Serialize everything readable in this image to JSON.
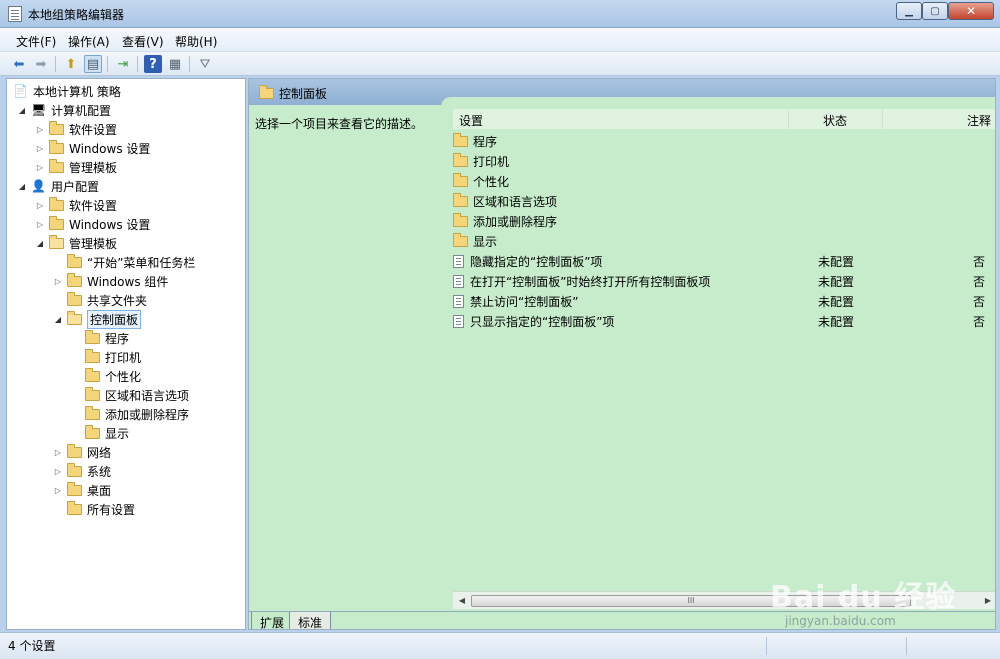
{
  "window": {
    "title": "本地组策略编辑器",
    "min_label": "▁",
    "max_label": "▢",
    "close_label": "✕"
  },
  "menu": [
    "文件(F)",
    "操作(A)",
    "查看(V)",
    "帮助(H)"
  ],
  "toolbar": {
    "icons": [
      "back-icon",
      "forward-icon",
      "up-folder-icon",
      "show-hide-tree-icon",
      "export-icon",
      "help-icon",
      "properties-icon",
      "filter-icon"
    ],
    "glyphs": {
      "back": "⬅",
      "forward": "➡",
      "up": "⬆",
      "tree": "▤",
      "export": "⇥",
      "help": "?",
      "props": "▦",
      "filter": "⛛"
    }
  },
  "tree": {
    "root": "本地计算机 策略",
    "computer_config": "计算机配置",
    "computer_software": "软件设置",
    "computer_windows": "Windows 设置",
    "computer_admin": "管理模板",
    "user_config": "用户配置",
    "user_software": "软件设置",
    "user_windows": "Windows 设置",
    "user_admin": "管理模板",
    "start_menu": "“开始”菜单和任务栏",
    "windows_components": "Windows 组件",
    "shared_folders": "共享文件夹",
    "control_panel": "控制面板",
    "cp_children": [
      "程序",
      "打印机",
      "个性化",
      "区域和语言选项",
      "添加或删除程序",
      "显示"
    ],
    "network": "网络",
    "system": "系统",
    "desktop": "桌面",
    "all_settings": "所有设置"
  },
  "right": {
    "header_title": "控制面板",
    "description": "选择一个项目来查看它的描述。",
    "columns": {
      "setting": "设置",
      "state": "状态",
      "comment": "注释"
    },
    "folders": [
      "程序",
      "打印机",
      "个性化",
      "区域和语言选项",
      "添加或删除程序",
      "显示"
    ],
    "policies": [
      {
        "name": "隐藏指定的“控制面板”项",
        "state": "未配置",
        "comment": "否"
      },
      {
        "name": "在打开“控制面板”时始终打开所有控制面板项",
        "state": "未配置",
        "comment": "否"
      },
      {
        "name": "禁止访问“控制面板”",
        "state": "未配置",
        "comment": "否"
      },
      {
        "name": "只显示指定的“控制面板”项",
        "state": "未配置",
        "comment": "否"
      }
    ],
    "scroll_grip": "III",
    "tabs": [
      "扩展",
      "标准"
    ]
  },
  "status": {
    "text": "4 个设置"
  },
  "watermark": {
    "brand": "Bai  du 经验",
    "url": "jingyan.baidu.com"
  }
}
